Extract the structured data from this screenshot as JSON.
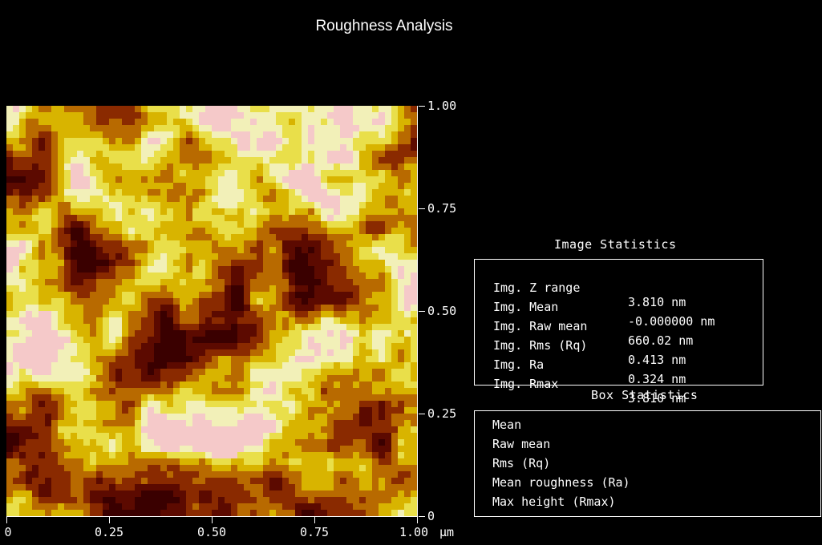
{
  "title": "Roughness Analysis",
  "afm_image": {
    "colormap": [
      "#3a0000",
      "#5c0a00",
      "#8a2a00",
      "#b86a00",
      "#d8b400",
      "#e9df4a",
      "#f2f0b8",
      "#f5c9c9"
    ],
    "y_ticks": [
      "0",
      "0.25",
      "0.50",
      "0.75",
      "1.00"
    ],
    "x_ticks": [
      "0",
      "0.25",
      "0.50",
      "0.75",
      "1.00"
    ],
    "x_unit": "µm"
  },
  "image_statistics": {
    "title": "Image Statistics",
    "rows": [
      {
        "label": "Img. Z range",
        "value": "3.810 nm"
      },
      {
        "label": "Img. Mean",
        "value": "-0.000000 nm"
      },
      {
        "label": "Img. Raw mean",
        "value": "660.02 nm"
      },
      {
        "label": "Img. Rms (Rq)",
        "value": "0.413 nm"
      },
      {
        "label": "Img. Ra",
        "value": "0.324 nm"
      },
      {
        "label": "Img. Rmax",
        "value": "3.810 nm"
      }
    ]
  },
  "box_statistics": {
    "title": "Box Statistics",
    "rows": [
      {
        "label": "Mean"
      },
      {
        "label": "Raw mean"
      },
      {
        "label": "Rms (Rq)"
      },
      {
        "label": "Mean roughness (Ra)"
      },
      {
        "label": "Max height (Rmax)"
      }
    ]
  }
}
